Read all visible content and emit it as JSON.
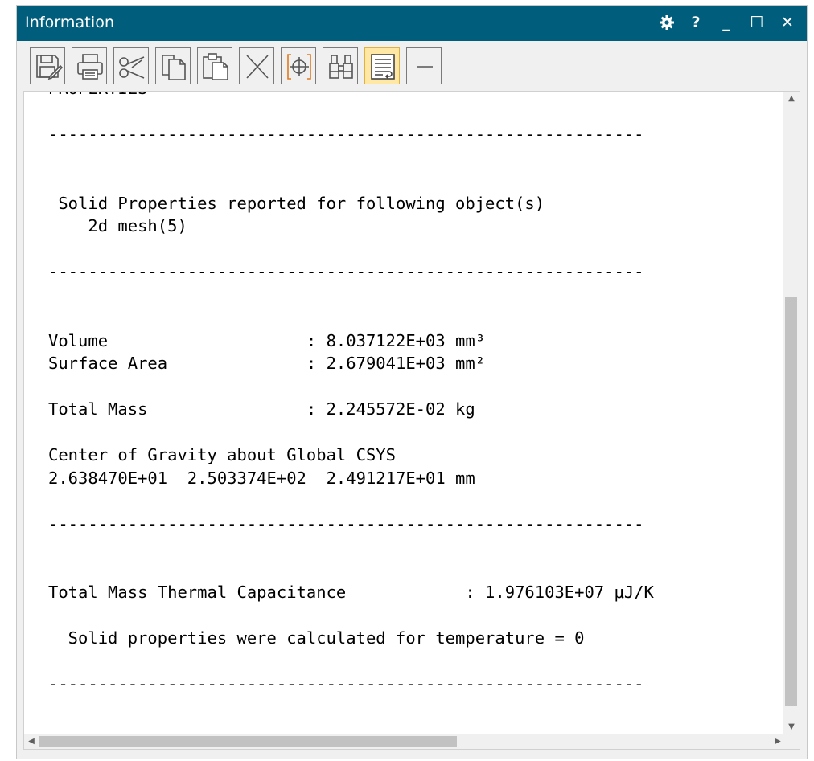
{
  "window": {
    "title": "Information",
    "controls": {
      "settings_icon": "gear-icon",
      "help": "?",
      "minimize": "_",
      "maximize": "☐",
      "close": "✕"
    }
  },
  "toolbar": {
    "buttons": [
      {
        "name": "save-edit-icon"
      },
      {
        "name": "print-icon"
      },
      {
        "name": "cut-icon"
      },
      {
        "name": "copy-icon"
      },
      {
        "name": "paste-icon"
      },
      {
        "name": "clear-icon"
      },
      {
        "name": "crosshair-icon"
      },
      {
        "name": "find-binoculars-icon"
      },
      {
        "name": "word-wrap-icon",
        "active": true
      },
      {
        "name": "minus-icon"
      }
    ]
  },
  "content": {
    "lines": [
      "PROPERTIES",
      "",
      "------------------------------------------------------------",
      "",
      "",
      " Solid Properties reported for following object(s)",
      "    2d_mesh(5)",
      "",
      "------------------------------------------------------------",
      "",
      "",
      "Volume                    : 8.037122E+03 mm³",
      "Surface Area              : 2.679041E+03 mm²",
      "",
      "Total Mass                : 2.245572E-02 kg",
      "",
      "Center of Gravity about Global CSYS",
      "2.638470E+01  2.503374E+02  2.491217E+01 mm",
      "",
      "------------------------------------------------------------",
      "",
      "",
      "Total Mass Thermal Capacitance            : 1.976103E+07 μJ/K",
      "",
      "  Solid properties were calculated for temperature = 0",
      "",
      "------------------------------------------------------------"
    ]
  },
  "scrollbars": {
    "up": "▲",
    "down": "▼",
    "left": "◀",
    "right": "▶"
  }
}
